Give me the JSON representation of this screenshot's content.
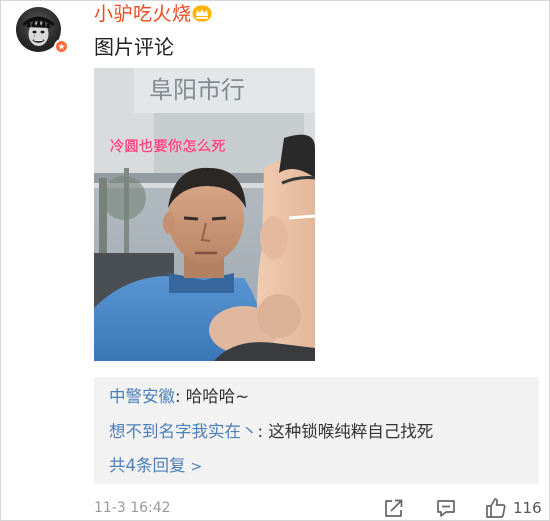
{
  "post": {
    "username": "小驴吃火烧",
    "text": "图片评论",
    "photo_caption": "冷圆也要你怎么死",
    "photo_sign": "阜阳市行"
  },
  "comments": {
    "replies": [
      {
        "author": "中警安徽",
        "text": ": 哈哈哈~"
      },
      {
        "author": "想不到名字我实在丶",
        "text": ": 这种锁喉纯粹自己找死"
      }
    ],
    "more_label": "共4条回复",
    "more_arrow": ">"
  },
  "footer": {
    "timestamp": "11-3 16:42",
    "like_count": "116"
  },
  "icons": {
    "avatar": "avatar-portrait",
    "badge": "verified-badge-icon",
    "vip": "vip-crown-icon",
    "share": "share-icon",
    "comment": "comment-icon",
    "like": "thumbs-up-icon"
  },
  "colors": {
    "username": "#f04b1c",
    "link": "#4d7fb8",
    "comment_bg": "#f2f2f2",
    "caption": "#ff4f86",
    "meta": "#9a9a9a"
  }
}
